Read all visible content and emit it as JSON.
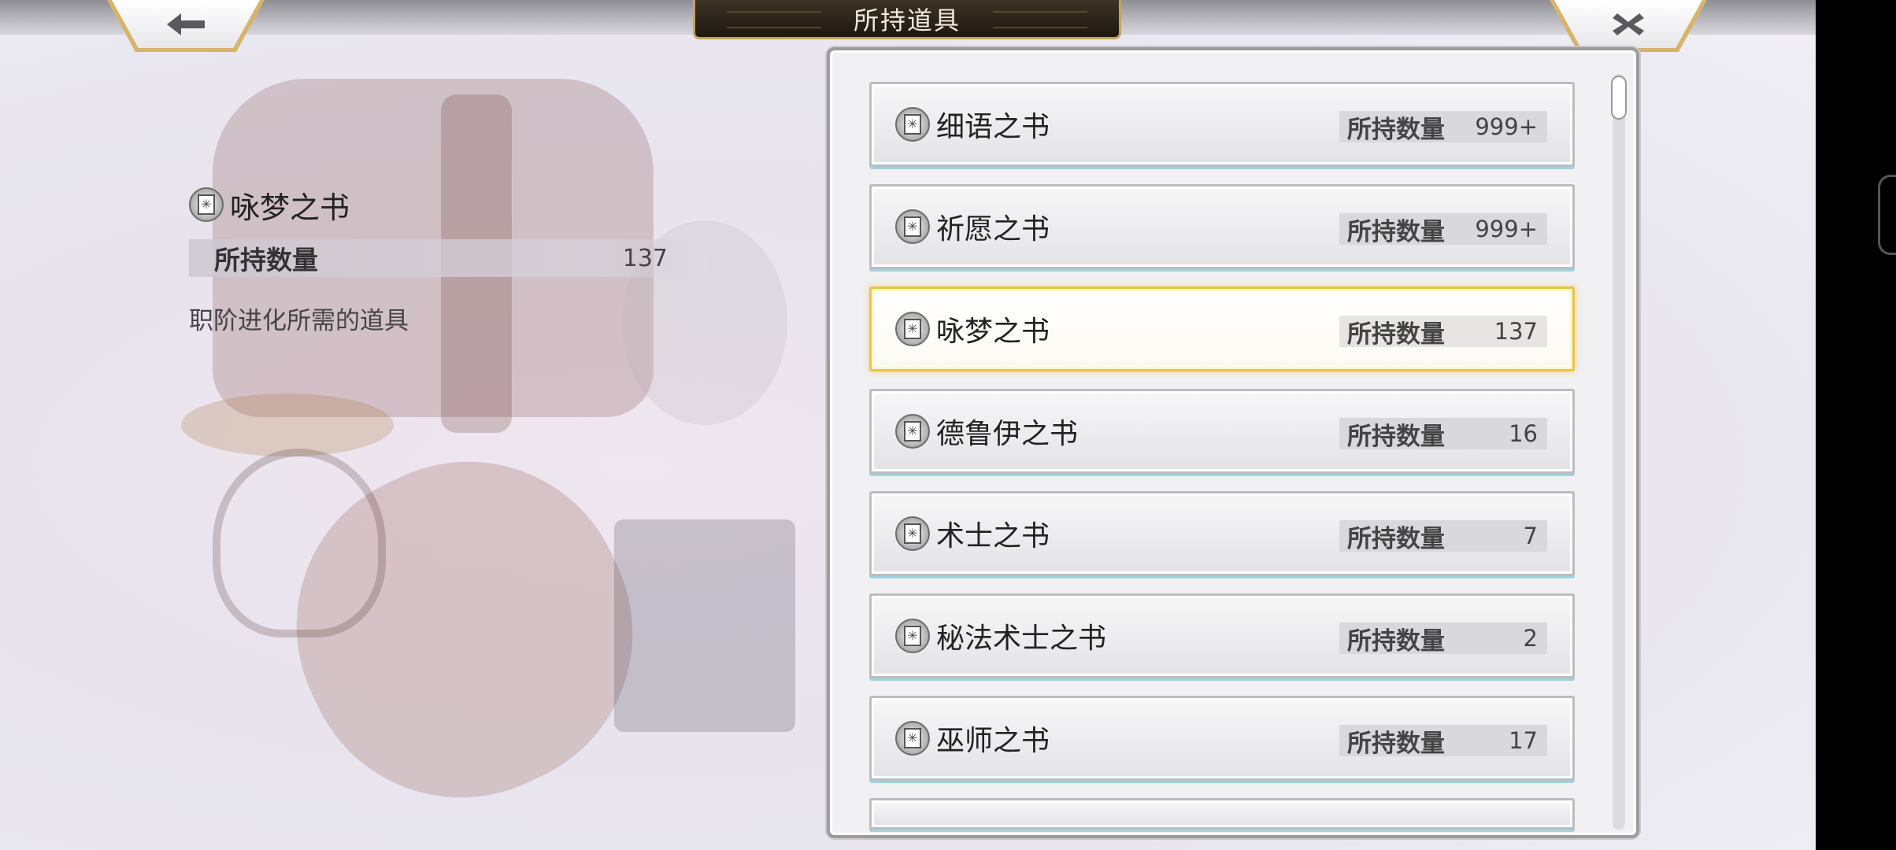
{
  "header": {
    "title": "所持道具",
    "back_icon": "arrow-left-icon",
    "close_icon": "close-x-icon"
  },
  "detail": {
    "name": "咏梦之书",
    "icon": "book-icon",
    "count_label": "所持数量",
    "count_value": "137",
    "description": "职阶进化所需的道具"
  },
  "list": {
    "items": [
      {
        "name": "细语之书",
        "count_label": "所持数量",
        "count": "999+",
        "selected": false
      },
      {
        "name": "祈愿之书",
        "count_label": "所持数量",
        "count": "999+",
        "selected": false
      },
      {
        "name": "咏梦之书",
        "count_label": "所持数量",
        "count": "137",
        "selected": true
      },
      {
        "name": "德鲁伊之书",
        "count_label": "所持数量",
        "count": "16",
        "selected": false
      },
      {
        "name": "术士之书",
        "count_label": "所持数量",
        "count": "7",
        "selected": false
      },
      {
        "name": "秘法术士之书",
        "count_label": "所持数量",
        "count": "2",
        "selected": false
      },
      {
        "name": "巫师之书",
        "count_label": "所持数量",
        "count": "17",
        "selected": false
      }
    ]
  },
  "colors": {
    "selected_border": "#e9c34c",
    "title_plate": "#2a2219",
    "accent_gold": "#c7a45a"
  }
}
